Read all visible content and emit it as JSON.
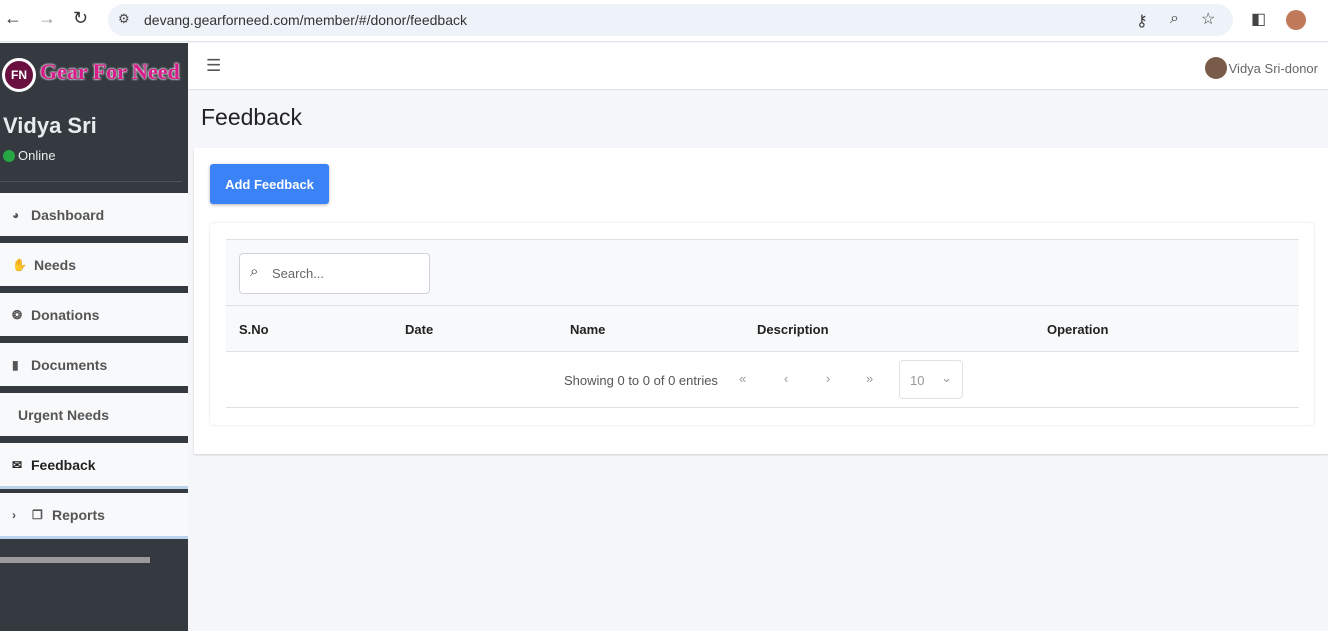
{
  "browser": {
    "url": "devang.gearforneed.com/member/#/donor/feedback"
  },
  "sidebar": {
    "logo_text": "Gear For Need",
    "logo_mark": "FN",
    "user_name": "Vidya Sri",
    "status": "Online",
    "items": [
      {
        "label": "Dashboard",
        "icon": "pie-chart-icon"
      },
      {
        "label": "Needs",
        "icon": "hand-holding-icon"
      },
      {
        "label": "Donations",
        "icon": "donate-icon"
      },
      {
        "label": "Documents",
        "icon": "file-icon"
      },
      {
        "label": "Urgent Needs",
        "icon": ""
      },
      {
        "label": "Feedback",
        "icon": "envelope-icon"
      },
      {
        "label": "Reports",
        "icon": "copy-icon"
      }
    ]
  },
  "topbar": {
    "user": "Vidya Sri-donor"
  },
  "page": {
    "title": "Feedback",
    "add_button": "Add Feedback"
  },
  "table": {
    "search_placeholder": "Search...",
    "columns": [
      "S.No",
      "Date",
      "Name",
      "Description",
      "Operation"
    ],
    "rows": [],
    "info": "Showing 0 to 0 of 0 entries",
    "page_size": "10"
  }
}
